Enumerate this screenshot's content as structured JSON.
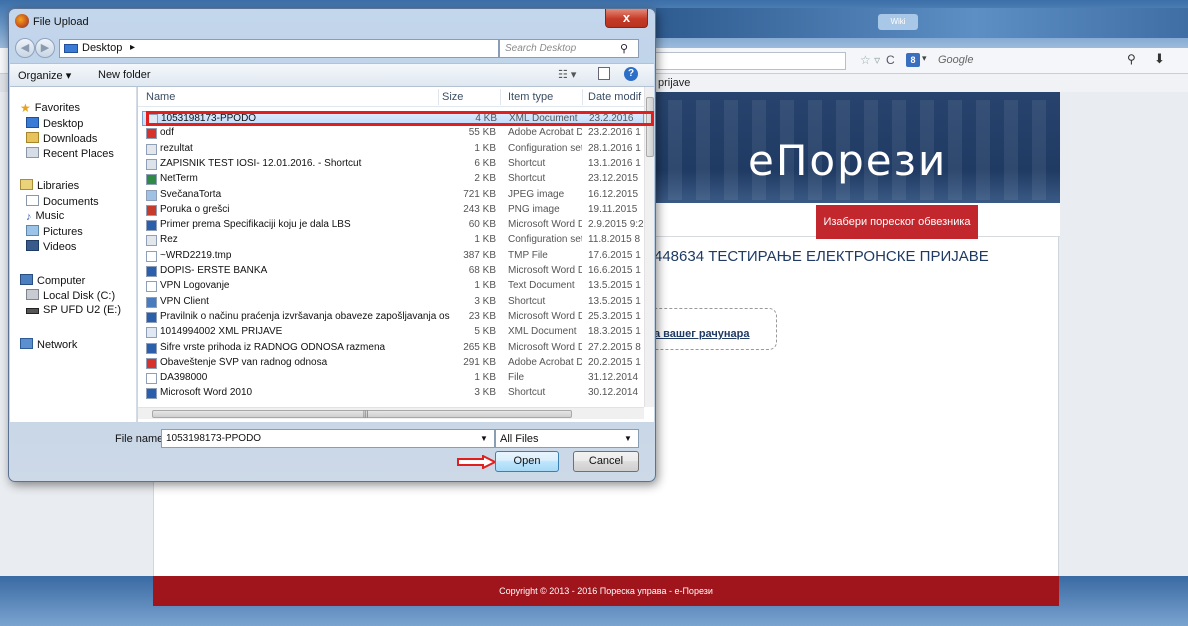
{
  "colors": {
    "highlight": "#e0201f",
    "banner": "#1f3a63",
    "accent_red": "#c1272d",
    "footer": "#a0141b"
  },
  "browser": {
    "tab_stub": "Wiki",
    "search_engine_placeholder": "Google",
    "bookmark": "prijave"
  },
  "site": {
    "logo": "еПорези",
    "choose_button": "Изабери пореског обвезника",
    "heading": "448634 ТЕСТИРАЊЕ ЕЛЕКТРОНСКЕ ПРИЈАВЕ",
    "upload_link": "а вашег рачунара",
    "footer": "Copyright © 2013 - 2016 Пореска управа - е-Порези"
  },
  "dialog": {
    "title": "File Upload",
    "close_glyph": "x",
    "address": "Desktop",
    "search_placeholder": "Search Desktop",
    "toolbar": {
      "organize": "Organize ▾",
      "new_folder": "New folder"
    },
    "nav": {
      "favorites": "Favorites",
      "desktop": "Desktop",
      "downloads": "Downloads",
      "recent": "Recent Places",
      "libraries": "Libraries",
      "documents": "Documents",
      "music": "Music",
      "pictures": "Pictures",
      "videos": "Videos",
      "computer": "Computer",
      "local_disk": "Local Disk (C:)",
      "usb": "SP UFD U2 (E:)",
      "network": "Network"
    },
    "columns": {
      "name": "Name",
      "size": "Size",
      "type": "Item type",
      "date": "Date modif"
    },
    "files": [
      {
        "name": "1053198173-PPODO",
        "size": "4 KB",
        "type": "XML Document",
        "date": "23.2.2016",
        "icon": "xml-file-icon"
      },
      {
        "name": "odf",
        "size": "55 KB",
        "type": "Adobe Acrobat D...",
        "date": "23.2.2016 1",
        "icon": "pdf-file-icon"
      },
      {
        "name": "rezultat",
        "size": "1 KB",
        "type": "Configuration sett...",
        "date": "28.1.2016 1",
        "icon": "config-file-icon"
      },
      {
        "name": "ZAPISNIK TEST IOSI- 12.01.2016. - Shortcut",
        "size": "6 KB",
        "type": "Shortcut",
        "date": "13.1.2016 1",
        "icon": "shortcut-icon"
      },
      {
        "name": "NetTerm",
        "size": "2 KB",
        "type": "Shortcut",
        "date": "23.12.2015",
        "icon": "app-shortcut-icon"
      },
      {
        "name": "SvečanaTorta",
        "size": "721 KB",
        "type": "JPEG image",
        "date": "16.12.2015",
        "icon": "image-file-icon"
      },
      {
        "name": "Poruka o grešci",
        "size": "243 KB",
        "type": "PNG image",
        "date": "19.11.2015",
        "icon": "png-file-icon"
      },
      {
        "name": "Primer prema Specifikaciji koju je dala LBS",
        "size": "60 KB",
        "type": "Microsoft Word D...",
        "date": "2.9.2015 9:2",
        "icon": "word-file-icon"
      },
      {
        "name": "Rez",
        "size": "1 KB",
        "type": "Configuration sett...",
        "date": "11.8.2015 8",
        "icon": "config-file-icon"
      },
      {
        "name": "~WRD2219.tmp",
        "size": "387 KB",
        "type": "TMP File",
        "date": "17.6.2015 1",
        "icon": "blank-file-icon"
      },
      {
        "name": "DOPIS- ERSTE BANKA",
        "size": "68 KB",
        "type": "Microsoft Word D...",
        "date": "16.6.2015 1",
        "icon": "word-file-icon"
      },
      {
        "name": "VPN Logovanje",
        "size": "1 KB",
        "type": "Text Document",
        "date": "13.5.2015 1",
        "icon": "text-file-icon"
      },
      {
        "name": "VPN Client",
        "size": "3 KB",
        "type": "Shortcut",
        "date": "13.5.2015 1",
        "icon": "vpn-shortcut-icon"
      },
      {
        "name": "Pravilnik o načinu praćenja izvršavanja obaveze zapošljavanja oso...",
        "size": "23 KB",
        "type": "Microsoft Word D...",
        "date": "25.3.2015 1",
        "icon": "word-file-icon"
      },
      {
        "name": "1014994002 XML PRIJAVE",
        "size": "5 KB",
        "type": "XML Document",
        "date": "18.3.2015 1",
        "icon": "xml-file-icon"
      },
      {
        "name": "Šifre vrste prihoda iz RADNOG ODNOSA razmena",
        "size": "265 KB",
        "type": "Microsoft Word D...",
        "date": "27.2.2015 8",
        "icon": "word-file-icon"
      },
      {
        "name": "Obaveštenje ŠVP van radnog odnosa",
        "size": "291 KB",
        "type": "Adobe Acrobat D...",
        "date": "20.2.2015 1",
        "icon": "pdf-file-icon"
      },
      {
        "name": "DA398000",
        "size": "1 KB",
        "type": "File",
        "date": "31.12.2014",
        "icon": "blank-file-icon"
      },
      {
        "name": "Microsoft Word 2010",
        "size": "3 KB",
        "type": "Shortcut",
        "date": "30.12.2014",
        "icon": "word-shortcut-icon"
      }
    ],
    "file_name_label": "File name:",
    "file_name_value": "1053198173-PPODO",
    "filter": "All Files",
    "open_button": "Open",
    "cancel_button": "Cancel"
  }
}
